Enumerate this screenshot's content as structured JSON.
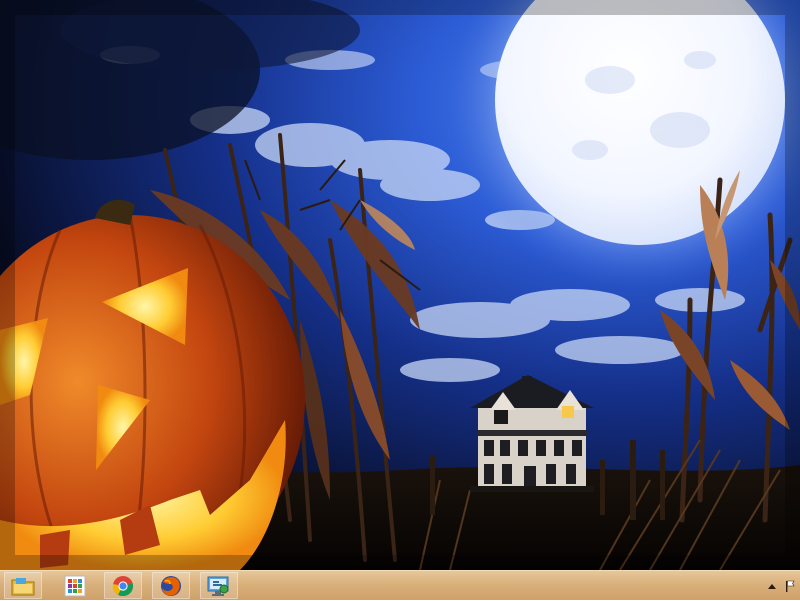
{
  "desktop": {
    "wallpaper": "halloween-pumpkin-haunted-house",
    "sky_color": "#1b3fa6",
    "moon_color": "#f5f8ff",
    "pumpkin_color": "#e0661a"
  },
  "taskbar": {
    "background": "#d9b07b",
    "apps": [
      {
        "name": "file-explorer",
        "icon": "folder-icon"
      },
      {
        "name": "apps",
        "icon": "start-tiles-icon"
      },
      {
        "name": "google-chrome",
        "icon": "chrome-icon"
      },
      {
        "name": "firefox",
        "icon": "firefox-icon"
      },
      {
        "name": "control-panel",
        "icon": "control-panel-icon"
      }
    ],
    "tray": {
      "show_hidden_icon": "chevron-up-icon",
      "flag_icon": "action-center-flag-icon"
    }
  }
}
